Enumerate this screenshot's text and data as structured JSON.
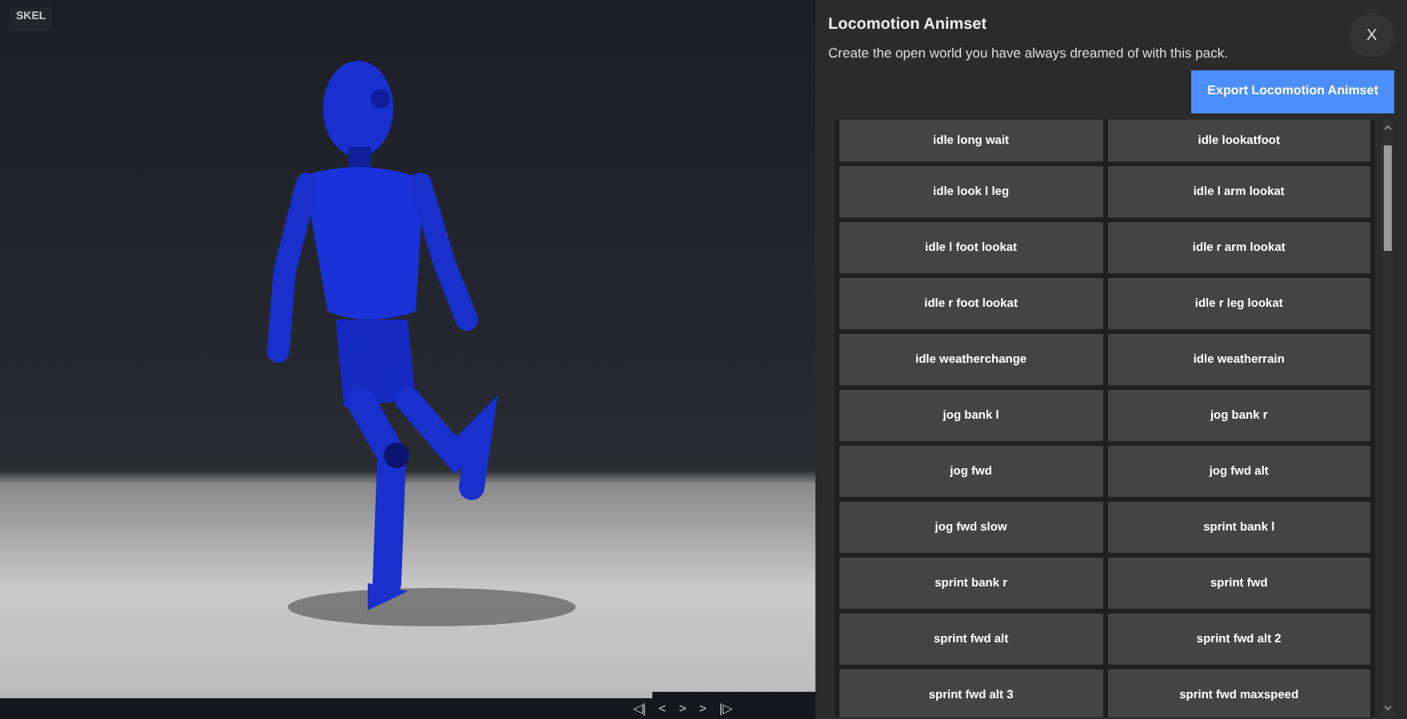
{
  "viewport": {
    "badge": "SKEL"
  },
  "timeline": {
    "level": 0.8,
    "controls": [
      "◁|",
      "<",
      ">",
      ">",
      "|▷"
    ]
  },
  "panel": {
    "title": "Locomotion Animset",
    "subtitle": "Create the open world you have always dreamed of with this pack.",
    "close": "X",
    "export_button": "Export Locomotion Animset"
  },
  "animations": [
    "idle long wait",
    "idle lookatfoot",
    "idle look l leg",
    "idle l arm lookat",
    "idle l foot lookat",
    "idle r arm lookat",
    "idle r foot lookat",
    "idle r leg lookat",
    "idle weatherchange",
    "idle weatherrain",
    "jog bank l",
    "jog bank r",
    "jog fwd",
    "jog fwd alt",
    "jog fwd slow",
    "sprint bank l",
    "sprint bank r",
    "sprint fwd",
    "sprint fwd alt",
    "sprint fwd alt 2",
    "sprint fwd alt 3",
    "sprint fwd maxspeed"
  ]
}
